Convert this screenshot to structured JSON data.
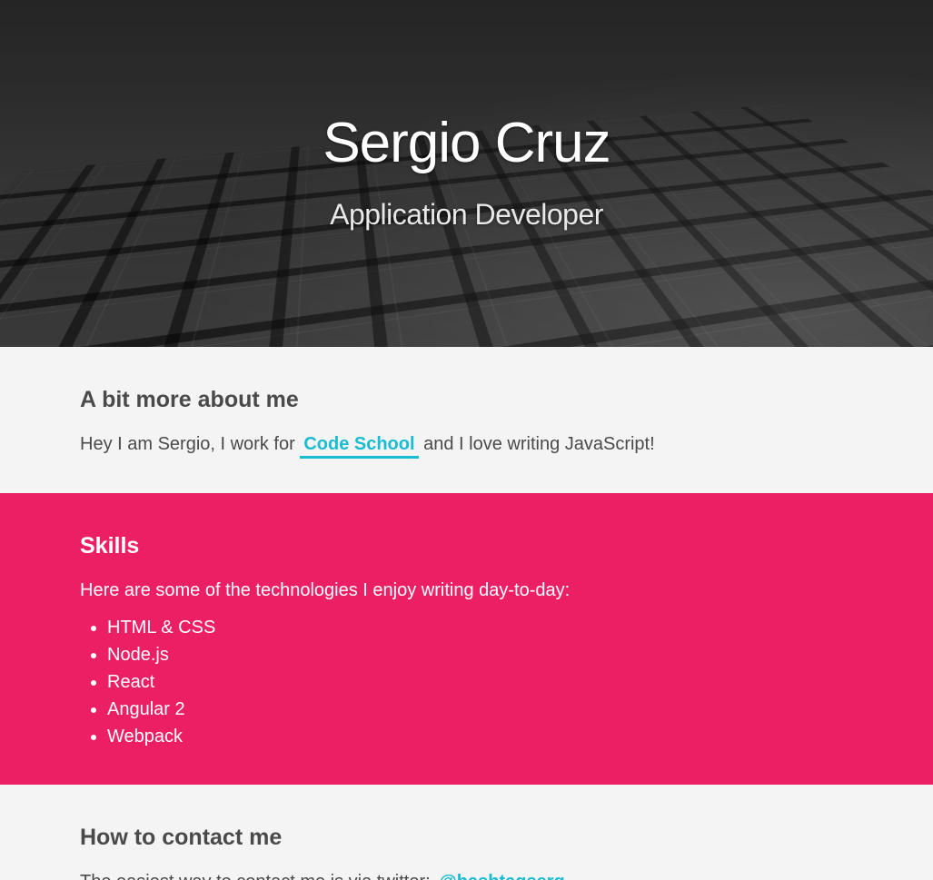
{
  "hero": {
    "title": "Sergio Cruz",
    "subtitle": "Application Developer"
  },
  "about": {
    "heading": "A bit more about me",
    "text_before": "Hey I am Sergio, I work for",
    "link_label": "Code School",
    "text_after": "and I love writing JavaScript!"
  },
  "skills": {
    "heading": "Skills",
    "intro": "Here are some of the technologies I enjoy writing day-to-day:",
    "items": [
      "HTML & CSS",
      "Node.js",
      "React",
      "Angular 2",
      "Webpack"
    ]
  },
  "contact": {
    "heading": "How to contact me",
    "text": "The easiest way to contact me is via twitter:",
    "handle": "@hashtagserg"
  },
  "colors": {
    "accent_pink": "#ec1f65",
    "link_cyan": "#19bcd0",
    "text_gray": "#4a4a4a",
    "background": "#f4f4f4"
  }
}
